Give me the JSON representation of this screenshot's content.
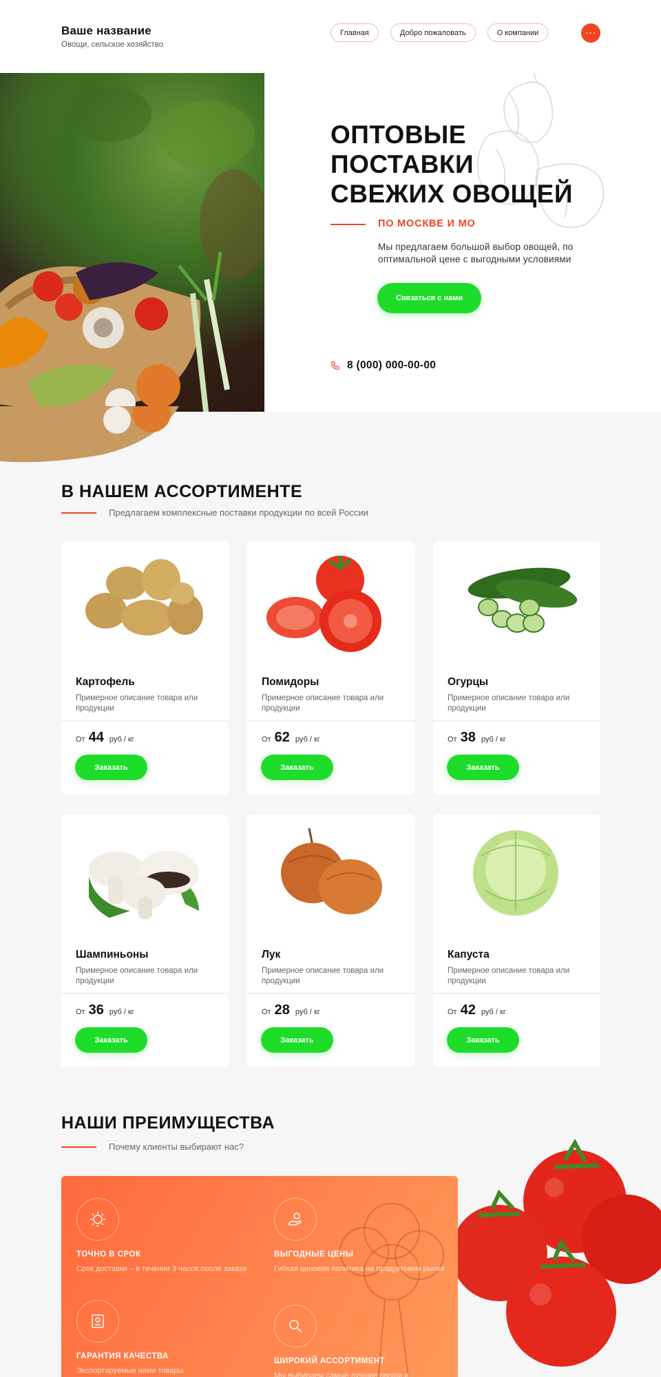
{
  "header": {
    "brand_title": "Ваше название",
    "brand_subtitle": "Овощи, сельское хозяйство",
    "nav": [
      {
        "label": "Главная"
      },
      {
        "label": "Добро пожаловать"
      },
      {
        "label": "О компании"
      }
    ],
    "menu_symbol": "..."
  },
  "hero": {
    "title_lines": [
      "ОПТОВЫЕ",
      "ПОСТАВКИ",
      "СВЕЖИХ ОВОЩЕЙ"
    ],
    "subtitle": "ПО МОСКВЕ И МО",
    "description": "Мы предлагаем большой выбор овощей, по оптимальной цене с выгодными условиями",
    "cta_label": "Связаться с нами",
    "phone": "8 (000) 000-00-00"
  },
  "assortment": {
    "title": "В НАШЕМ АССОРТИМЕНТЕ",
    "subtitle": "Предлагаем комплексные поставки продукции по всей России",
    "products": [
      {
        "name": "Картофель",
        "description": "Примерное описание товара или продукции",
        "price_from": "От",
        "price": "44",
        "unit": "руб / кг",
        "order_label": "Заказать"
      },
      {
        "name": "Помидоры",
        "description": "Примерное описание товара или продукции",
        "price_from": "От",
        "price": "62",
        "unit": "руб / кг",
        "order_label": "Заказать"
      },
      {
        "name": "Огурцы",
        "description": "Примерное описание товара или продукции",
        "price_from": "От",
        "price": "38",
        "unit": "руб / кг",
        "order_label": "Заказать"
      },
      {
        "name": "Шампиньоны",
        "description": "Примерное описание товара или продукции",
        "price_from": "От",
        "price": "36",
        "unit": "руб / кг",
        "order_label": "Заказать"
      },
      {
        "name": "Лук",
        "description": "Примерное описание товара или продукции",
        "price_from": "От",
        "price": "28",
        "unit": "руб / кг",
        "order_label": "Заказать"
      },
      {
        "name": "Капуста",
        "description": "Примерное описание товара или продукции",
        "price_from": "От",
        "price": "42",
        "unit": "руб / кг",
        "order_label": "Заказать"
      }
    ]
  },
  "advantages": {
    "title": "НАШИ ПРЕИМУЩЕСТВА",
    "subtitle": "Почему клиенты выбирают нас?",
    "items": [
      {
        "title": "ТОЧНО В СРОК",
        "description": "Срок доставки – в течении 3 часов после заказа",
        "icon": "sun-clock-icon"
      },
      {
        "title": "ВЫГОДНЫЕ ЦЕНЫ",
        "description": "Гибкая ценовая политика на продуктовом рынке",
        "icon": "price-hand-icon"
      },
      {
        "title": "ГАРАНТИЯ КАЧЕСТВА",
        "description": "Экспортируемые нами товары",
        "icon": "certificate-icon"
      },
      {
        "title": "ШИРОКИЙ АССОРТИМЕНТ",
        "description": "Мы выбираем самые лучшие овощи и",
        "icon": "search-icon"
      }
    ]
  },
  "colors": {
    "accent": "#f04423",
    "button_green": "#1edc2a",
    "page_bg": "#f6f6f6",
    "advantages_bg": "#ff7f4a"
  }
}
